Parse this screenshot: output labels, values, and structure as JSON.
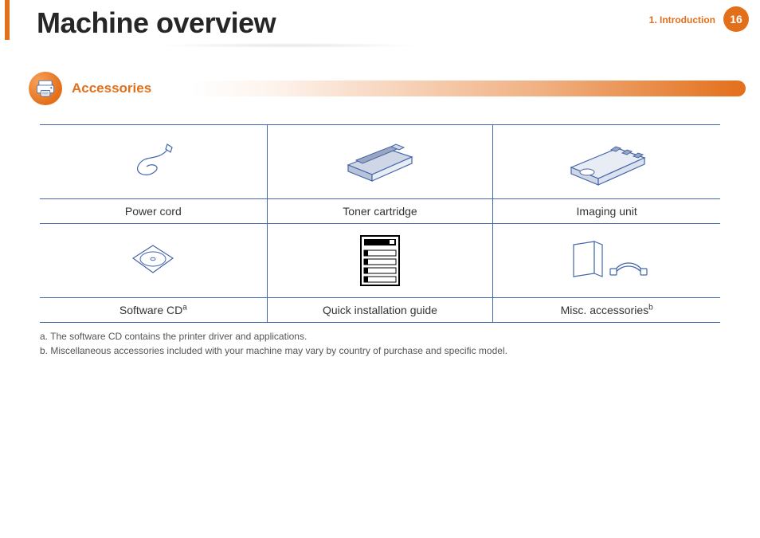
{
  "header": {
    "title": "Machine overview",
    "chapter_label": "1.  Introduction",
    "page_number": "16"
  },
  "section": {
    "heading": "Accessories"
  },
  "table": {
    "row1": {
      "c1_label": "Power cord",
      "c2_label": "Toner cartridge",
      "c3_label": "Imaging unit"
    },
    "row2": {
      "c1_label": "Software CD",
      "c1_sup": "a",
      "c2_label": "Quick installation guide",
      "c3_label": "Misc. accessories",
      "c3_sup": "b"
    }
  },
  "footnotes": {
    "a": "a. The software CD contains the printer driver and applications.",
    "b": "b. Miscellaneous accessories included with your machine may vary by country of purchase and specific model."
  }
}
